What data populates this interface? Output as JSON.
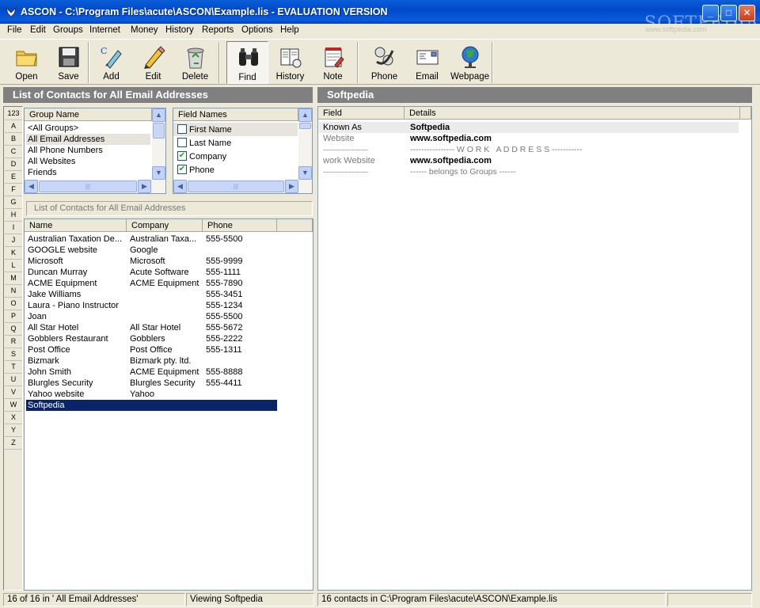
{
  "window": {
    "title": "ASCON - C:\\Program Files\\acute\\ASCON\\Example.lis - EVALUATION VERSION",
    "watermark": "SOFTPEDIA",
    "watermark_url": "www.softpedia.com",
    "controls": {
      "minimize": "_",
      "maximize": "□",
      "close": "✕"
    }
  },
  "menu": [
    "File",
    "Edit",
    "Groups",
    "Internet",
    "Money",
    "History",
    "Reports",
    "Options",
    "Help"
  ],
  "toolbar": {
    "open": "Open",
    "save": "Save",
    "add": "Add",
    "edit": "Edit",
    "delete": "Delete",
    "find": "Find",
    "history": "History",
    "note": "Note",
    "phone": "Phone",
    "email": "Email",
    "webpage": "Webpage"
  },
  "left_panel": {
    "header": "List of Contacts for All Email Addresses",
    "alpha_index": [
      "123",
      "A",
      "B",
      "C",
      "D",
      "E",
      "F",
      "G",
      "H",
      "I",
      "J",
      "K",
      "L",
      "M",
      "N",
      "O",
      "P",
      "Q",
      "R",
      "S",
      "T",
      "U",
      "V",
      "W",
      "X",
      "Y",
      "Z"
    ],
    "groups": {
      "column": "Group Name",
      "items": [
        "<All Groups>",
        "All Email Addresses",
        "All Phone Numbers",
        "All Websites",
        "Friends"
      ],
      "selected_index": 1
    },
    "fields": {
      "column": "Field Names",
      "items": [
        {
          "label": "First Name",
          "checked": false
        },
        {
          "label": "Last Name",
          "checked": false
        },
        {
          "label": "Company",
          "checked": true
        },
        {
          "label": "Phone",
          "checked": true
        }
      ]
    },
    "filter_label": "List of Contacts for All Email Addresses",
    "contacts": {
      "columns": [
        "Name",
        "Company",
        "Phone"
      ],
      "rows": [
        [
          "Australian Taxation De...",
          "Australian Taxa...",
          "555-5500"
        ],
        [
          "GOOGLE website",
          "Google",
          ""
        ],
        [
          "Microsoft",
          "Microsoft",
          "555-9999"
        ],
        [
          "Duncan Murray",
          "Acute Software",
          "555-1111"
        ],
        [
          "ACME Equipment",
          "ACME Equipment",
          "555-7890"
        ],
        [
          "Jake Williams",
          "",
          "555-3451"
        ],
        [
          "Laura - Piano Instructor",
          "",
          "555-1234"
        ],
        [
          "Joan",
          "",
          "555-5500"
        ],
        [
          "All Star Hotel",
          "All Star Hotel",
          "555-5672"
        ],
        [
          "Gobblers Restaurant",
          "Gobblers",
          "555-2222"
        ],
        [
          "Post Office",
          "Post Office",
          "555-1311"
        ],
        [
          "Bizmark",
          "Bizmark pty. ltd.",
          ""
        ],
        [
          "John Smith",
          "ACME Equipment",
          "555-8888"
        ],
        [
          "Blurgles Security",
          "Blurgles Security",
          "555-4411"
        ],
        [
          "Yahoo website",
          "Yahoo",
          ""
        ],
        [
          "Softpedia",
          "",
          ""
        ]
      ],
      "selected_index": 15
    }
  },
  "right_panel": {
    "header": "Softpedia",
    "columns": [
      "Field",
      "Details"
    ],
    "rows": [
      {
        "field": "Known As",
        "details": "Softpedia",
        "style": "known"
      },
      {
        "field": "Website",
        "details": "www.softpedia.com",
        "style": "value"
      },
      {
        "field": "-------------------",
        "details": "---------------- W O R K   A D D R E S S -----------",
        "style": "sep"
      },
      {
        "field": "work Website",
        "details": "www.softpedia.com",
        "style": "value"
      },
      {
        "field": "-------------------",
        "details": "------ belongs to Groups ------",
        "style": "sep"
      }
    ]
  },
  "status": {
    "count": "16 of  16  in ' All Email Addresses'",
    "viewing": "Viewing Softpedia",
    "file": "16 contacts in C:\\Program Files\\acute\\ASCON\\Example.lis",
    "extra": ""
  }
}
